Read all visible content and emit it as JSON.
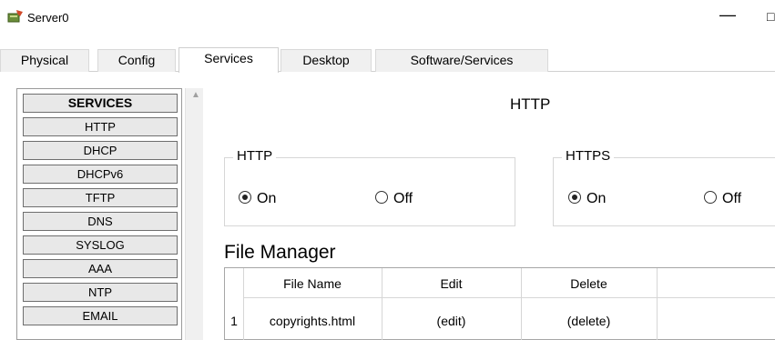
{
  "window": {
    "title": "Server0",
    "minimize_glyph": "—",
    "maximize_glyph": "□",
    "icon": "server-app-icon"
  },
  "tabs": [
    {
      "label": "Physical",
      "active": false
    },
    {
      "label": "Config",
      "active": false
    },
    {
      "label": "Services",
      "active": true
    },
    {
      "label": "Desktop",
      "active": false
    },
    {
      "label": "Software/Services",
      "active": false
    }
  ],
  "services": {
    "header": "SERVICES",
    "items": [
      "HTTP",
      "DHCP",
      "DHCPv6",
      "TFTP",
      "DNS",
      "SYSLOG",
      "AAA",
      "NTP",
      "EMAIL"
    ]
  },
  "http_panel": {
    "title": "HTTP",
    "http_group": {
      "label": "HTTP",
      "on_label": "On",
      "off_label": "Off",
      "selected": "On"
    },
    "https_group": {
      "label": "HTTPS",
      "on_label": "On",
      "off_label": "Off",
      "selected": "On"
    }
  },
  "file_manager": {
    "title": "File Manager",
    "columns": [
      "File Name",
      "Edit",
      "Delete"
    ],
    "rows": [
      {
        "index": "1",
        "file_name": "copyrights.html",
        "edit": "(edit)",
        "delete": "(delete)"
      }
    ]
  },
  "colors": {
    "tab_active_bg": "#ffffff",
    "service_button_bg": "#e8e8e8",
    "border": "#9a9a9a"
  }
}
